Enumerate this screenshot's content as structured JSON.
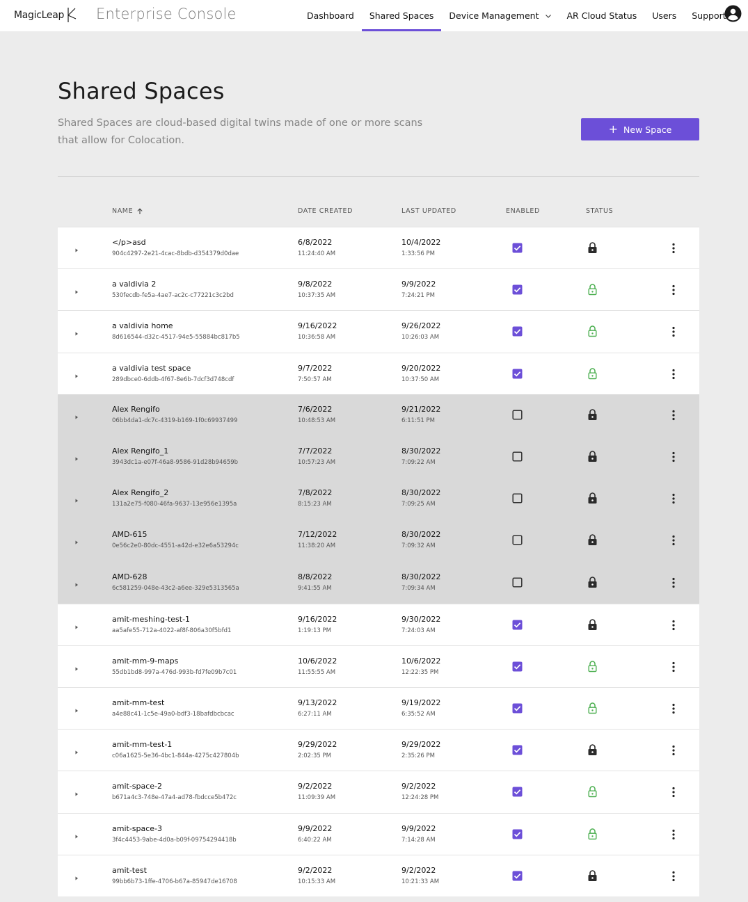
{
  "header": {
    "logo_text": "MagicLeap",
    "console_title": "Enterprise Console",
    "nav": [
      {
        "label": "Dashboard",
        "active": false
      },
      {
        "label": "Shared Spaces",
        "active": true
      },
      {
        "label": "Device Management",
        "active": false,
        "has_dropdown": true
      },
      {
        "label": "AR Cloud Status",
        "active": false
      },
      {
        "label": "Users",
        "active": false
      },
      {
        "label": "Support",
        "active": false
      }
    ],
    "avatar_icon": "account-circle-icon"
  },
  "page": {
    "title": "Shared Spaces",
    "description": "Shared Spaces are cloud-based digital twins made of one or more scans that allow for Colocation.",
    "new_button_label": "New Space"
  },
  "colors": {
    "accent": "#6c4fd8",
    "unlocked_green": "#4caf50",
    "locked_dark": "#2b2b2b",
    "disabled_row_bg": "#d9d9d9"
  },
  "table": {
    "columns": {
      "name": "NAME",
      "date_created": "DATE CREATED",
      "last_updated": "LAST UPDATED",
      "enabled": "ENABLED",
      "status": "STATUS"
    },
    "sort": {
      "column": "name",
      "direction": "asc"
    },
    "rows": [
      {
        "name": "</p>asd",
        "id": "904c4297-2e21-4cac-8bdb-d354379d0dae",
        "created_date": "6/8/2022",
        "created_time": "11:24:40 AM",
        "updated_date": "10/4/2022",
        "updated_time": "1:33:56 PM",
        "enabled": true,
        "locked": true
      },
      {
        "name": "a valdivia 2",
        "id": "530fecdb-fe5a-4ae7-ac2c-c77221c3c2bd",
        "created_date": "9/8/2022",
        "created_time": "10:37:35 AM",
        "updated_date": "9/9/2022",
        "updated_time": "7:24:21 PM",
        "enabled": true,
        "locked": false
      },
      {
        "name": "a valdivia home",
        "id": "8d616544-d32c-4517-94e5-55884bc817b5",
        "created_date": "9/16/2022",
        "created_time": "10:36:58 AM",
        "updated_date": "9/26/2022",
        "updated_time": "10:26:03 AM",
        "enabled": true,
        "locked": false
      },
      {
        "name": "a valdivia test space",
        "id": "289dbce0-6ddb-4f67-8e6b-7dcf3d748cdf",
        "created_date": "9/7/2022",
        "created_time": "7:50:57 AM",
        "updated_date": "9/20/2022",
        "updated_time": "10:37:50 AM",
        "enabled": true,
        "locked": false
      },
      {
        "name": "Alex Rengifo",
        "id": "06bb4da1-dc7c-4319-b169-1f0c69937499",
        "created_date": "7/6/2022",
        "created_time": "10:48:53 AM",
        "updated_date": "9/21/2022",
        "updated_time": "6:11:51 PM",
        "enabled": false,
        "locked": true
      },
      {
        "name": "Alex Rengifo_1",
        "id": "3943dc1a-e07f-46a8-9586-91d28b94659b",
        "created_date": "7/7/2022",
        "created_time": "10:57:23 AM",
        "updated_date": "8/30/2022",
        "updated_time": "7:09:22 AM",
        "enabled": false,
        "locked": true
      },
      {
        "name": "Alex Rengifo_2",
        "id": "131a2e75-f080-46fa-9637-13e956e1395a",
        "created_date": "7/8/2022",
        "created_time": "8:15:23 AM",
        "updated_date": "8/30/2022",
        "updated_time": "7:09:25 AM",
        "enabled": false,
        "locked": true
      },
      {
        "name": "AMD-615",
        "id": "0e56c2e0-80dc-4551-a42d-e32e6a53294c",
        "created_date": "7/12/2022",
        "created_time": "11:38:20 AM",
        "updated_date": "8/30/2022",
        "updated_time": "7:09:32 AM",
        "enabled": false,
        "locked": true
      },
      {
        "name": "AMD-628",
        "id": "6c581259-048e-43c2-a6ee-329e5313565a",
        "created_date": "8/8/2022",
        "created_time": "9:41:55 AM",
        "updated_date": "8/30/2022",
        "updated_time": "7:09:34 AM",
        "enabled": false,
        "locked": true
      },
      {
        "name": "amit-meshing-test-1",
        "id": "aa5afe55-712a-4022-af8f-806a30f5bfd1",
        "created_date": "9/16/2022",
        "created_time": "1:19:13 PM",
        "updated_date": "9/30/2022",
        "updated_time": "7:24:03 AM",
        "enabled": true,
        "locked": true
      },
      {
        "name": "amit-mm-9-maps",
        "id": "55db1bd8-997a-476d-993b-fd7fe09b7c01",
        "created_date": "10/6/2022",
        "created_time": "11:55:55 AM",
        "updated_date": "10/6/2022",
        "updated_time": "12:22:35 PM",
        "enabled": true,
        "locked": false
      },
      {
        "name": "amit-mm-test",
        "id": "a4e88c41-1c5e-49a0-bdf3-18bafdbcbcac",
        "created_date": "9/13/2022",
        "created_time": "6:27:11 AM",
        "updated_date": "9/19/2022",
        "updated_time": "6:35:52 AM",
        "enabled": true,
        "locked": false
      },
      {
        "name": "amit-mm-test-1",
        "id": "c06a1625-5e36-4bc1-844a-4275c427804b",
        "created_date": "9/29/2022",
        "created_time": "2:02:35 PM",
        "updated_date": "9/29/2022",
        "updated_time": "2:35:26 PM",
        "enabled": true,
        "locked": true
      },
      {
        "name": "amit-space-2",
        "id": "b671a4c3-748e-47a4-ad78-fbdcce5b472c",
        "created_date": "9/2/2022",
        "created_time": "11:09:39 AM",
        "updated_date": "9/2/2022",
        "updated_time": "12:24:28 PM",
        "enabled": true,
        "locked": false
      },
      {
        "name": "amit-space-3",
        "id": "3f4c4453-9abe-4d0a-b09f-09754294418b",
        "created_date": "9/9/2022",
        "created_time": "6:40:22 AM",
        "updated_date": "9/9/2022",
        "updated_time": "7:14:28 AM",
        "enabled": true,
        "locked": false
      },
      {
        "name": "amit-test",
        "id": "99bb6b73-1ffe-4706-b67a-85947de16708",
        "created_date": "9/2/2022",
        "created_time": "10:15:33 AM",
        "updated_date": "9/2/2022",
        "updated_time": "10:21:33 AM",
        "enabled": true,
        "locked": true
      }
    ]
  }
}
